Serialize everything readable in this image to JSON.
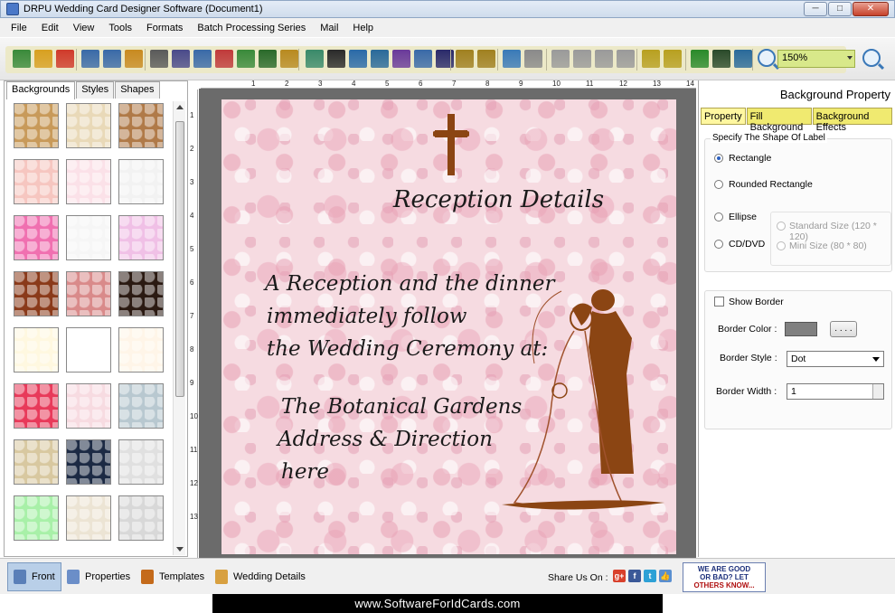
{
  "window": {
    "title": "DRPU Wedding Card Designer Software (Document1)",
    "buttons": {
      "minimize": "─",
      "maximize": "□",
      "close": "✕"
    }
  },
  "menu": [
    "File",
    "Edit",
    "View",
    "Tools",
    "Formats",
    "Batch Processing Series",
    "Mail",
    "Help"
  ],
  "toolbar": {
    "zoom_value": "150%",
    "icons": [
      "new-icon",
      "open-icon",
      "close-doc-icon",
      "save-icon",
      "save-as-icon",
      "export-icon",
      "properties-icon",
      "print-icon",
      "print-preview-icon",
      "gift-icon",
      "add-image-icon",
      "pencil-icon",
      "shapes-icon",
      "watermark-icon",
      "barcode-icon",
      "text-icon",
      "image-icon",
      "signature-icon",
      "email-icon",
      "line-icon",
      "database-icon",
      "database2-icon",
      "undo-icon",
      "redo-icon",
      "copy-icon",
      "paste-icon",
      "cut-icon",
      "delete-icon",
      "bring-front-icon",
      "send-back-icon",
      "grid-icon",
      "actual-size-icon",
      "fit-icon",
      "zoom-in-icon",
      "zoom-out-icon"
    ]
  },
  "left_panel": {
    "tabs": [
      "Backgrounds",
      "Styles",
      "Shapes"
    ],
    "active_tab": "Backgrounds",
    "thumbnails": [
      {
        "color": "#c89a5a"
      },
      {
        "color": "#e9d9b8"
      },
      {
        "color": "#b07a48"
      },
      {
        "color": "#f6c6c0"
      },
      {
        "color": "#fbe1e8"
      },
      {
        "color": "#f2f2f2"
      },
      {
        "color": "#f070b0"
      },
      {
        "color": "#f6f6f6"
      },
      {
        "color": "#f0c0e6"
      },
      {
        "color": "#8a3a1a"
      },
      {
        "color": "#d98a8a"
      },
      {
        "color": "#2b1a12"
      },
      {
        "color": "#fff8e0"
      },
      {
        "color": "#ffffff"
      },
      {
        "color": "#fff5e8"
      },
      {
        "color": "#e83a5a"
      },
      {
        "color": "#f7dbe1"
      },
      {
        "color": "#b8c8d0"
      },
      {
        "color": "#d8c8a0"
      },
      {
        "color": "#1c2a44"
      },
      {
        "color": "#e0e0e0"
      },
      {
        "color": "#a8f0a8"
      },
      {
        "color": "#ece4d4"
      },
      {
        "color": "#d8d8d8"
      }
    ]
  },
  "ruler": {
    "h_labels": [
      "1",
      "2",
      "3",
      "4",
      "5",
      "6",
      "7",
      "8",
      "9",
      "10",
      "11",
      "12",
      "13",
      "14"
    ],
    "v_labels": [
      "1",
      "2",
      "3",
      "4",
      "5",
      "6",
      "7",
      "8",
      "9",
      "10",
      "11",
      "12",
      "13"
    ]
  },
  "card": {
    "heading": "Reception Details",
    "lines": [
      "A Reception and the dinner",
      "immediately follow",
      "the Wedding Ceremony at:"
    ],
    "venue": [
      "The Botanical Gardens",
      "Address & Direction",
      "here"
    ],
    "ornament_color": "#8b4513"
  },
  "right_panel": {
    "title": "Background Property",
    "tabs": [
      "Property",
      "Fill Background",
      "Background Effects"
    ],
    "active_tab": "Property",
    "shape_group_title": "Specify The Shape Of Label",
    "shapes": [
      {
        "label": "Rectangle",
        "selected": true
      },
      {
        "label": "Rounded Rectangle",
        "selected": false
      },
      {
        "label": "Ellipse",
        "selected": false
      },
      {
        "label": "CD/DVD",
        "selected": false
      }
    ],
    "cd_sizes": [
      "Standard Size (120 * 120)",
      "Mini Size (80 * 80)"
    ],
    "show_border_label": "Show Border",
    "border_color_label": "Border Color :",
    "border_color": "#808080",
    "dots_button": ". . . .",
    "border_style_label": "Border Style :",
    "border_style_value": "Dot",
    "border_width_label": "Border Width :",
    "border_width_value": "1"
  },
  "statusbar": {
    "tabs": [
      "Front",
      "Properties",
      "Templates",
      "Wedding Details"
    ],
    "active_tab": "Front",
    "share_label": "Share Us On :",
    "social": [
      "g+",
      "f",
      "t",
      "👍"
    ],
    "feedback_lines": [
      "WE ARE GOOD",
      "OR BAD? LET",
      "OTHERS KNOW..."
    ]
  },
  "footer": {
    "text": "www.SoftwareForIdCards.com"
  }
}
